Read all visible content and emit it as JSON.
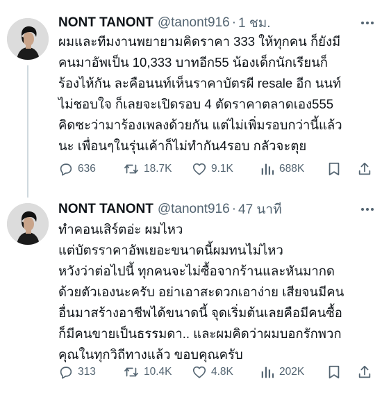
{
  "tweets": [
    {
      "author_name": "NONT TANONT",
      "handle": "@tanont916",
      "separator": "·",
      "time": "1 ชม.",
      "text_lines": [
        "ผมและทีมงานพยายามคิดราคา 333 ให้ทุกคน ก็ยังมี",
        "คนมาอัพเป็น 10,333 บาทอีก55 น้องเด็กนักเรียนก็",
        "ร้องไห้กัน ละคือนนท์เห็นราคาบัตรผี resale อีก นนท์",
        "ไม่ชอบใจ ก็เลยจะเปิดรอบ 4 ตัดราคาตลาดเอง555",
        "คิดซะว่ามาร้องเพลงด้วยกัน แต่ไม่เพิ่มรอบกว่านี้แล้ว",
        "นะ เพื่อนๆในรุ่นเค้าก็ไม่ทำกัน4รอบ กลัวจะตุย"
      ],
      "replies": "636",
      "reposts": "18.7K",
      "likes": "9.1K",
      "views": "688K"
    },
    {
      "author_name": "NONT TANONT",
      "handle": "@tanont916",
      "separator": "·",
      "time": "47 นาที",
      "text_lines": [
        "ทำคอนเสิร์ตอ่ะ ผมไหว",
        "แต่บัตรราคาอัพเยอะขนาดนี้ผมทนไม่ไหว",
        "หวังว่าต่อไปนี้ ทุกคนจะไม่ซื้อจากร้านและหันมากด",
        "ด้วยตัวเองนะครับ อย่าเอาสะดวกเอาง่าย เสียจนมีคน",
        "อื่นมาสร้างอาชีพได้ขนาดนี้ จุดเริ่มต้นเลยคือมีคนซื้อ",
        "ก็มีคนขายเป็นธรรมดา.. และผมคิดว่าผมบอกรักพวก",
        "คุณในทุกวิถีทางแล้ว ขอบคุณครับ"
      ],
      "replies": "313",
      "reposts": "10.4K",
      "likes": "4.8K",
      "views": "202K"
    }
  ],
  "colors": {
    "text": "#0f1419",
    "secondary": "#536471",
    "thread_line": "#cfd9de"
  },
  "icons": [
    "avatar",
    "more-icon",
    "reply-icon",
    "repost-icon",
    "like-icon",
    "views-icon",
    "bookmark-icon",
    "share-icon"
  ]
}
